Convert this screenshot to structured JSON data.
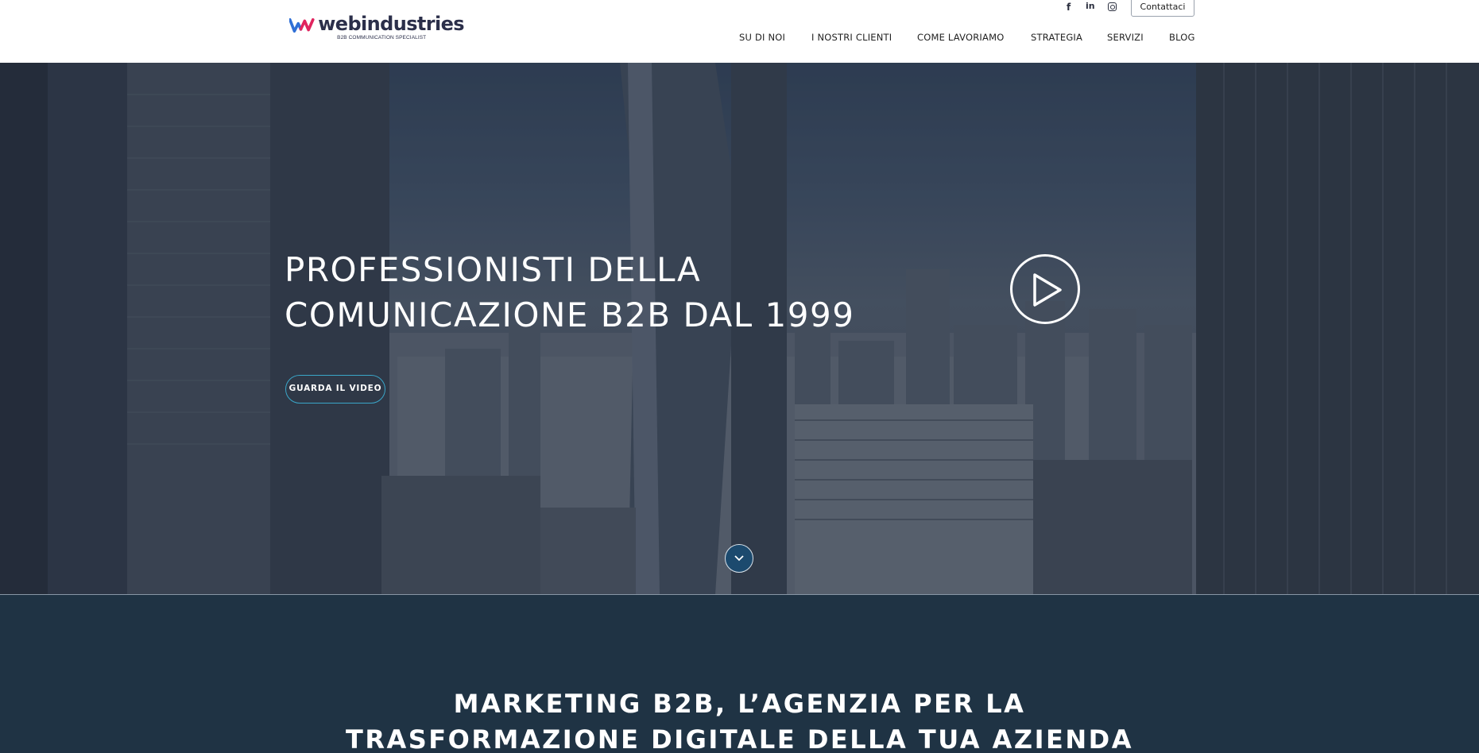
{
  "brand": {
    "name": "webindustries",
    "tagline": "B2B COMMUNICATION SPECIALIST",
    "colors": {
      "blue": "#2f6fd6",
      "magenta": "#e0245e",
      "dark": "#2b2f4a",
      "accent": "#3aa6c9"
    }
  },
  "header": {
    "social": [
      {
        "icon": "facebook-icon",
        "glyph": "f"
      },
      {
        "icon": "linkedin-icon",
        "glyph": "in"
      },
      {
        "icon": "instagram-icon",
        "glyph": ""
      }
    ],
    "contact_label": "Contattaci",
    "nav": [
      "SU DI NOI",
      "I NOSTRI CLIENTI",
      "COME LAVORIAMO",
      "STRATEGIA",
      "SERVIZI",
      "BLOG"
    ]
  },
  "hero": {
    "title_line1": "PROFESSIONISTI DELLA",
    "title_line2": "COMUNICAZIONE B2B DAL 1999",
    "video_button": "GUARDA IL VIDEO",
    "play_icon": "play-icon",
    "scroll_icon": "chevron-down-icon"
  },
  "section": {
    "title_line1": "MARKETING B2B, L’AGENZIA PER LA",
    "title_line2": "TRASFORMAZIONE DIGITALE DELLA TUA AZIENDA",
    "background": "#1f3344"
  }
}
